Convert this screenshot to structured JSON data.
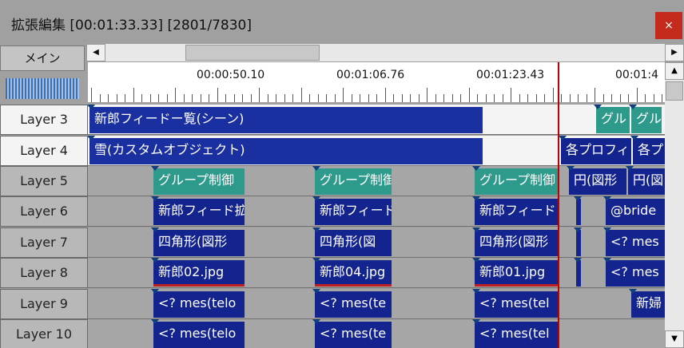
{
  "window": {
    "title": "拡張編集 [00:01:33.33] [2801/7830]",
    "close_label": "×"
  },
  "scene_tab": "メイン",
  "ruler": {
    "labels": [
      "00:00:50.10",
      "00:01:06.76",
      "00:01:23.43",
      "00:01:4"
    ]
  },
  "layers": [
    {
      "label": "Layer 3",
      "state": "active",
      "clips": [
        {
          "text": "新郎フィードー覧(シーン)",
          "style": "blue"
        },
        {
          "text": "グル",
          "style": "teal"
        },
        {
          "text": "グル",
          "style": "teal"
        }
      ]
    },
    {
      "label": "Layer 4",
      "state": "active",
      "clips": [
        {
          "text": "雪(カスタムオブジェクト)",
          "style": "blue"
        },
        {
          "text": "各プロフィ",
          "style": "navy"
        },
        {
          "text": "各プ",
          "style": "navy"
        }
      ]
    },
    {
      "label": "Layer 5",
      "state": "inactive",
      "clips": [
        {
          "text": "グループ制御",
          "style": "teal"
        },
        {
          "text": "グループ制御",
          "style": "teal"
        },
        {
          "text": "グループ制御",
          "style": "teal"
        },
        {
          "text": "円(図形",
          "style": "navy"
        },
        {
          "text": "円(図",
          "style": "navy"
        }
      ]
    },
    {
      "label": "Layer 6",
      "state": "inactive",
      "clips": [
        {
          "text": "新郎フィード拡",
          "style": "navy"
        },
        {
          "text": "新郎フィード",
          "style": "navy"
        },
        {
          "text": "新郎フィード",
          "style": "navy"
        },
        {
          "text": "",
          "style": "navy"
        },
        {
          "text": "@bride",
          "style": "navy"
        }
      ]
    },
    {
      "label": "Layer 7",
      "state": "inactive",
      "clips": [
        {
          "text": "四角形(図形",
          "style": "navy"
        },
        {
          "text": "四角形(図",
          "style": "navy"
        },
        {
          "text": "四角形(図形",
          "style": "navy"
        },
        {
          "text": "",
          "style": "navy"
        },
        {
          "text": "<? mes",
          "style": "navy"
        }
      ]
    },
    {
      "label": "Layer 8",
      "state": "inactive",
      "clips": [
        {
          "text": "新郎02.jpg",
          "style": "navy red-underline"
        },
        {
          "text": "新郎04.jpg",
          "style": "navy red-underline"
        },
        {
          "text": "新郎01.jpg",
          "style": "navy red-underline"
        },
        {
          "text": "",
          "style": "navy"
        },
        {
          "text": "<? mes",
          "style": "navy"
        }
      ]
    },
    {
      "label": "Layer 9",
      "state": "inactive",
      "clips": [
        {
          "text": "<? mes(telo",
          "style": "navy"
        },
        {
          "text": "<? mes(te",
          "style": "navy"
        },
        {
          "text": "<? mes(tel",
          "style": "navy"
        },
        {
          "text": "新婦",
          "style": "navy"
        }
      ]
    },
    {
      "label": "Layer 10",
      "state": "inactive",
      "clips": [
        {
          "text": "<? mes(telo",
          "style": "navy"
        },
        {
          "text": "<? mes(te",
          "style": "navy"
        },
        {
          "text": "<? mes(tel",
          "style": "navy"
        }
      ]
    }
  ]
}
